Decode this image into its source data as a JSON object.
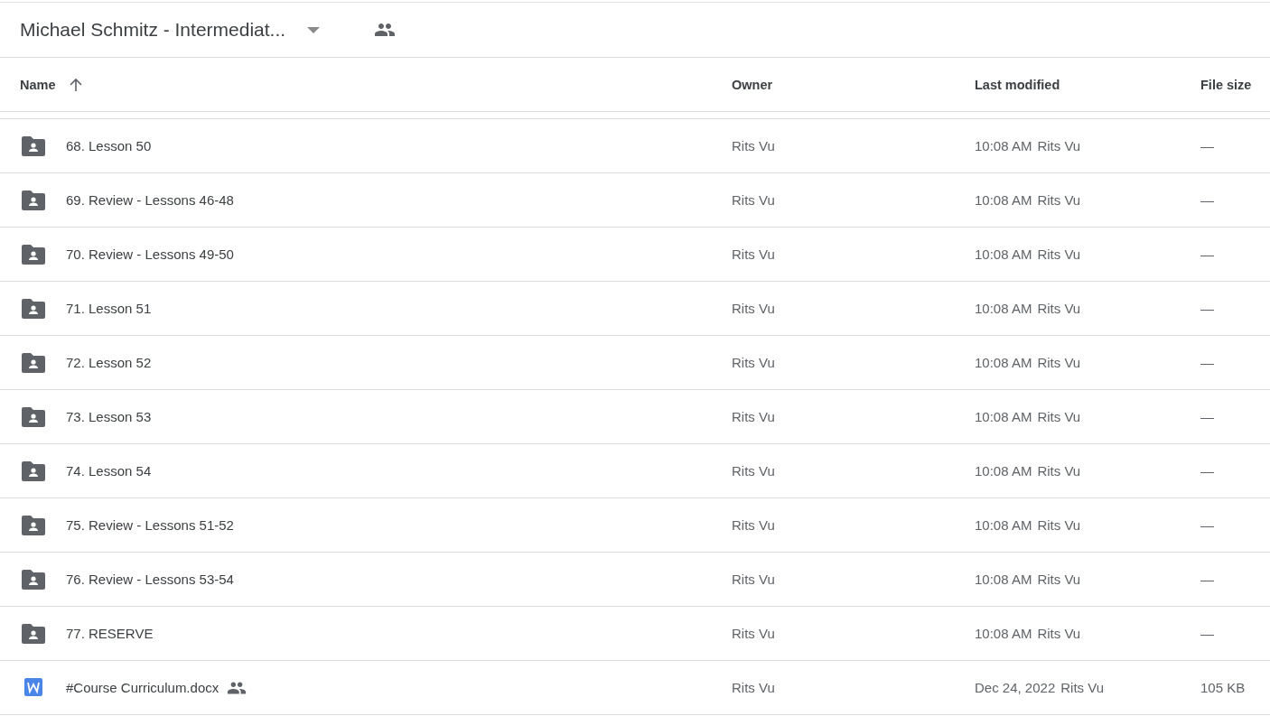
{
  "header": {
    "title": "Michael Schmitz - Intermediat...",
    "shared": true
  },
  "columns": [
    {
      "label": "Name",
      "sorted": true
    },
    {
      "label": "Owner",
      "sorted": false
    },
    {
      "label": "Last modified",
      "sorted": false
    },
    {
      "label": "File size",
      "sorted": false
    }
  ],
  "rows": [
    {
      "kind": "folder",
      "name": "68. Lesson 50",
      "shared": false,
      "owner": "Rits Vu",
      "modified": "10:08 AM",
      "modified_by": "Rits Vu",
      "size": "—"
    },
    {
      "kind": "folder",
      "name": "69. Review - Lessons 46-48",
      "shared": false,
      "owner": "Rits Vu",
      "modified": "10:08 AM",
      "modified_by": "Rits Vu",
      "size": "—"
    },
    {
      "kind": "folder",
      "name": "70. Review - Lessons 49-50",
      "shared": false,
      "owner": "Rits Vu",
      "modified": "10:08 AM",
      "modified_by": "Rits Vu",
      "size": "—"
    },
    {
      "kind": "folder",
      "name": "71. Lesson 51",
      "shared": false,
      "owner": "Rits Vu",
      "modified": "10:08 AM",
      "modified_by": "Rits Vu",
      "size": "—"
    },
    {
      "kind": "folder",
      "name": "72. Lesson 52",
      "shared": false,
      "owner": "Rits Vu",
      "modified": "10:08 AM",
      "modified_by": "Rits Vu",
      "size": "—"
    },
    {
      "kind": "folder",
      "name": "73. Lesson 53",
      "shared": false,
      "owner": "Rits Vu",
      "modified": "10:08 AM",
      "modified_by": "Rits Vu",
      "size": "—"
    },
    {
      "kind": "folder",
      "name": "74. Lesson 54",
      "shared": false,
      "owner": "Rits Vu",
      "modified": "10:08 AM",
      "modified_by": "Rits Vu",
      "size": "—"
    },
    {
      "kind": "folder",
      "name": "75. Review - Lessons 51-52",
      "shared": false,
      "owner": "Rits Vu",
      "modified": "10:08 AM",
      "modified_by": "Rits Vu",
      "size": "—"
    },
    {
      "kind": "folder",
      "name": "76. Review - Lessons 53-54",
      "shared": false,
      "owner": "Rits Vu",
      "modified": "10:08 AM",
      "modified_by": "Rits Vu",
      "size": "—"
    },
    {
      "kind": "folder",
      "name": "77. RESERVE",
      "shared": false,
      "owner": "Rits Vu",
      "modified": "10:08 AM",
      "modified_by": "Rits Vu",
      "size": "—"
    },
    {
      "kind": "word",
      "name": "#Course Curriculum.docx",
      "shared": true,
      "owner": "Rits Vu",
      "modified": "Dec 24, 2022",
      "modified_by": "Rits Vu",
      "size": "105 KB"
    }
  ]
}
